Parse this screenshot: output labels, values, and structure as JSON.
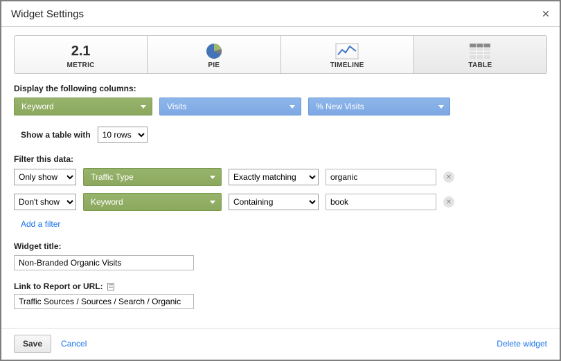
{
  "dialog": {
    "title": "Widget Settings"
  },
  "tabs": {
    "metric": {
      "label": "METRIC",
      "icon_value": "2.1"
    },
    "pie": {
      "label": "PIE"
    },
    "timeline": {
      "label": "TIMELINE"
    },
    "table": {
      "label": "TABLE"
    }
  },
  "columns": {
    "heading": "Display the following columns:",
    "dim": "Keyword",
    "metric1": "Visits",
    "metric2": "% New Visits"
  },
  "rows": {
    "label": "Show a table with",
    "value": "10 rows"
  },
  "filters": {
    "heading": "Filter this data:",
    "list": [
      {
        "mode": "Only show",
        "dimension": "Traffic Type",
        "match": "Exactly matching",
        "value": "organic"
      },
      {
        "mode": "Don't show",
        "dimension": "Keyword",
        "match": "Containing",
        "value": "book"
      }
    ],
    "add_label": "Add a filter"
  },
  "widget_title": {
    "label": "Widget title:",
    "value": "Non-Branded Organic Visits"
  },
  "link": {
    "label": "Link to Report or URL:",
    "value": "Traffic Sources / Sources / Search / Organic"
  },
  "footer": {
    "save": "Save",
    "cancel": "Cancel",
    "delete": "Delete widget"
  }
}
